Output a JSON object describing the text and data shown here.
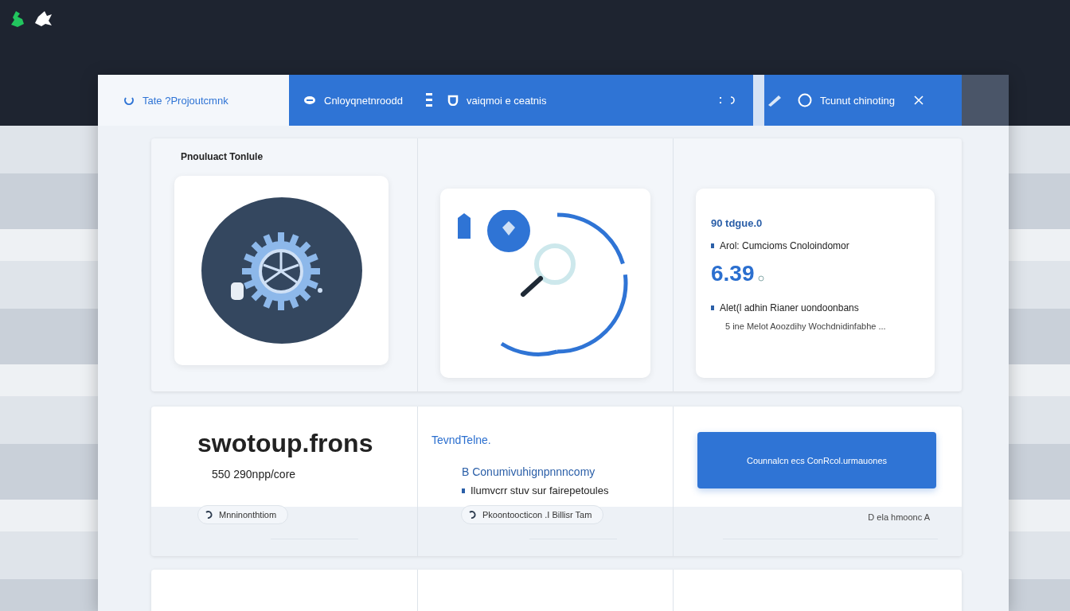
{
  "tabs": [
    {
      "label": "Tate ?Projoutcmnk",
      "selected": true
    },
    {
      "label": "Cnloyqnetnroodd",
      "selected": false
    },
    {
      "label": "vaiqmoi e ceatnis",
      "selected": false
    },
    {
      "label": "Tcunut chinoting",
      "selected": false
    }
  ],
  "top_panels": [
    {
      "kind": "gear",
      "title": "Pnouluact Tonlule"
    },
    {
      "kind": "search"
    },
    {
      "kind": "stats",
      "heading": "90 tdgue.0",
      "subtitle": "Arol: Cumcioms Cnoloindomor",
      "value": "6.39",
      "lines": [
        "Alet(l adhin Rianer uondoonbans",
        "5 ine Melot Aoozdihy Wochdnidinfabhe ..."
      ]
    }
  ],
  "bottom_panels": [
    {
      "kind": "headline",
      "headline": "swotoup.frons",
      "sub": "550 290npp/core",
      "chip": "Mnninonthtiom"
    },
    {
      "kind": "list",
      "heading": "TevndTelne.",
      "title": "B Conumivuhignpnnncomy",
      "bullet": "Ilumvcrr stuv sur fairepetoules",
      "chip": "Pkoontoocticon .I Billisr Tam"
    },
    {
      "kind": "action",
      "button": "Counnalcn ecs ConRcol.urmauones",
      "footer": "D ela hmoonc A"
    }
  ]
}
